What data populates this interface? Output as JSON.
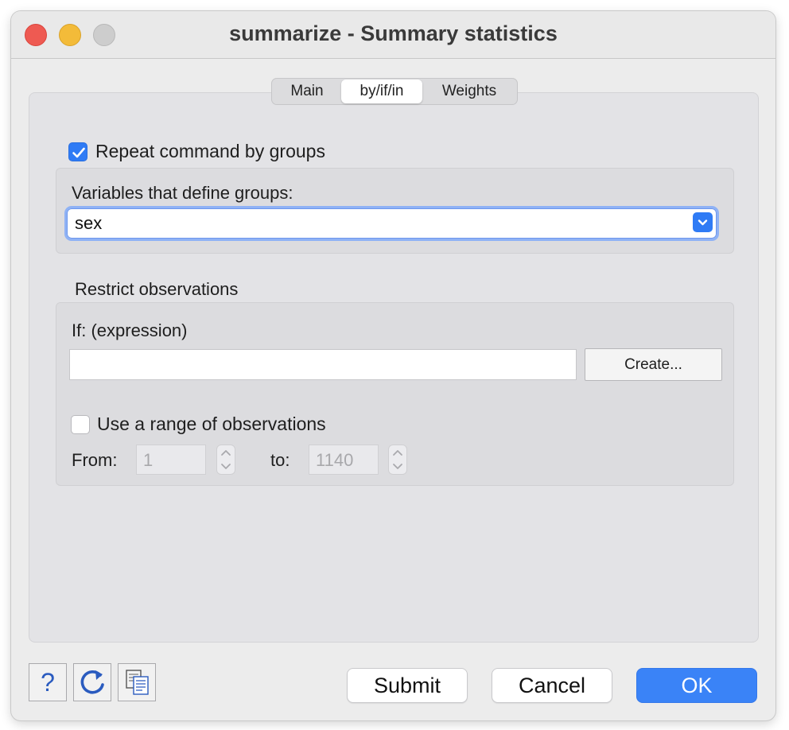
{
  "window": {
    "title": "summarize - Summary statistics"
  },
  "tabs": [
    {
      "label": "Main",
      "selected": false
    },
    {
      "label": "by/if/in",
      "selected": true
    },
    {
      "label": "Weights",
      "selected": false
    }
  ],
  "by_section": {
    "repeat_label": "Repeat command by groups",
    "repeat_checked": true,
    "groups_label": "Variables that define groups:",
    "groups_value": "sex"
  },
  "restrict_section": {
    "heading": "Restrict observations",
    "if_label": "If: (expression)",
    "if_value": "",
    "create_label": "Create...",
    "range_label": "Use a range of observations",
    "range_checked": false,
    "from_label": "From:",
    "from_value": "1",
    "to_label": "to:",
    "to_value": "1140"
  },
  "footer": {
    "help_icon": "question-mark-icon",
    "reset_icon": "reset-icon",
    "copy_icon": "copy-command-icon",
    "submit_label": "Submit",
    "cancel_label": "Cancel",
    "ok_label": "OK"
  },
  "colors": {
    "accent": "#2f7bf5",
    "close": "#ee5a52",
    "minimize": "#f3bb39",
    "zoom_disabled": "#cdcdcd"
  }
}
